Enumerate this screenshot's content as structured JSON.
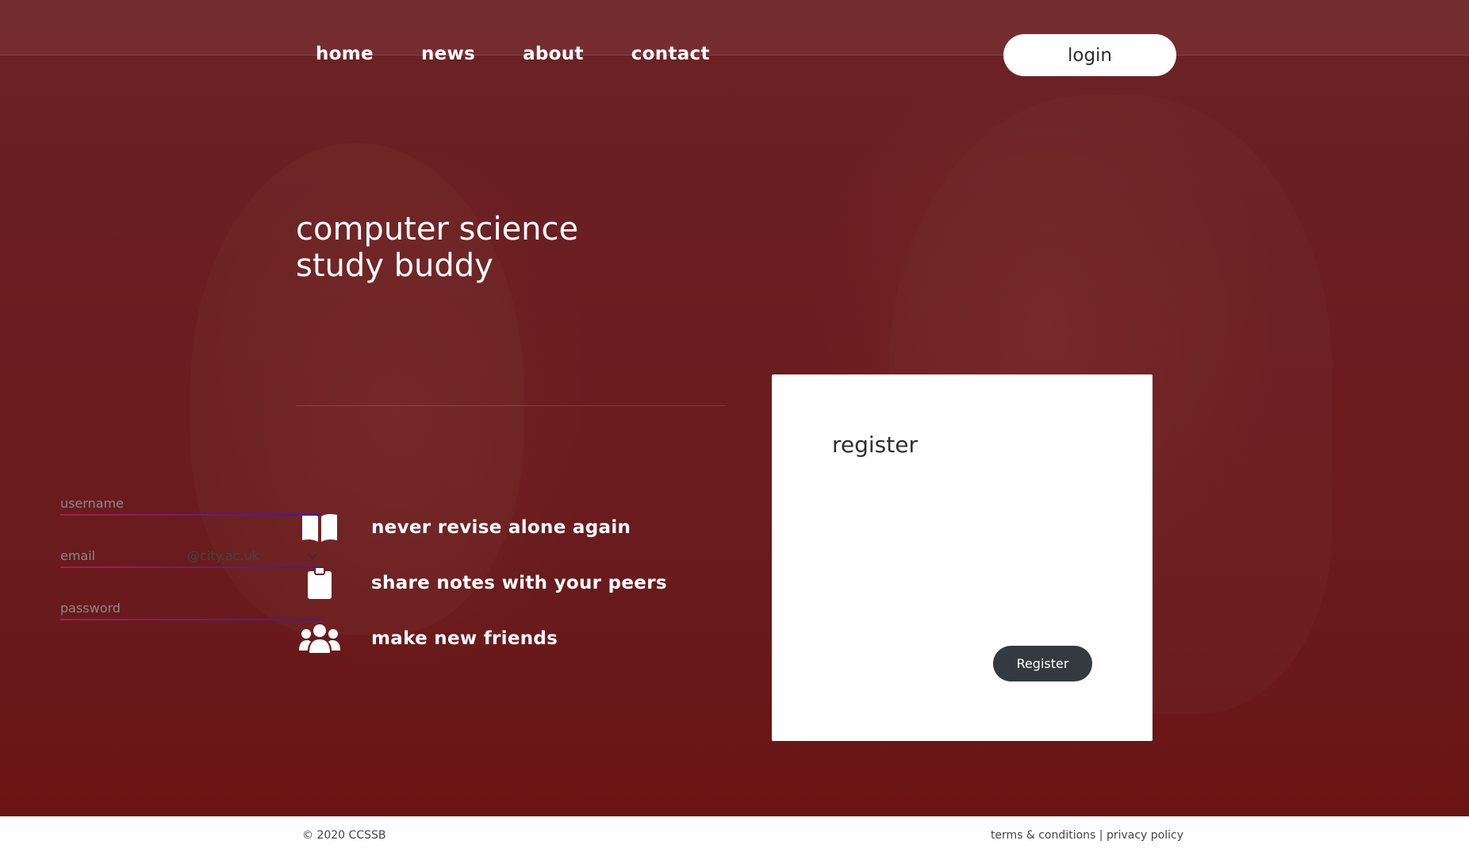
{
  "nav": {
    "items": [
      {
        "label": "home"
      },
      {
        "label": "news"
      },
      {
        "label": "about"
      },
      {
        "label": "contact"
      }
    ],
    "login_label": "login"
  },
  "hero": {
    "title_line1": "computer science",
    "title_line2": "study buddy"
  },
  "features": [
    {
      "icon": "open-book-icon",
      "text": "never revise alone again"
    },
    {
      "icon": "clipboard-icon",
      "text": "share notes with your peers"
    },
    {
      "icon": "users-icon",
      "text": "make new friends"
    }
  ],
  "register": {
    "title": "register",
    "username_placeholder": "username",
    "email_placeholder": "email",
    "email_domain": "@city.ac.uk",
    "password_placeholder": "password",
    "submit_label": "Register"
  },
  "footer": {
    "copyright": "© 2020 CCSSB",
    "terms": "terms & conditions",
    "separator": "|",
    "privacy": "privacy policy"
  },
  "colors": {
    "hero_bg": "#6a1d20",
    "button_dark": "#343a40",
    "underline_start": "#b01c4a",
    "underline_end": "#3a1aa8"
  }
}
